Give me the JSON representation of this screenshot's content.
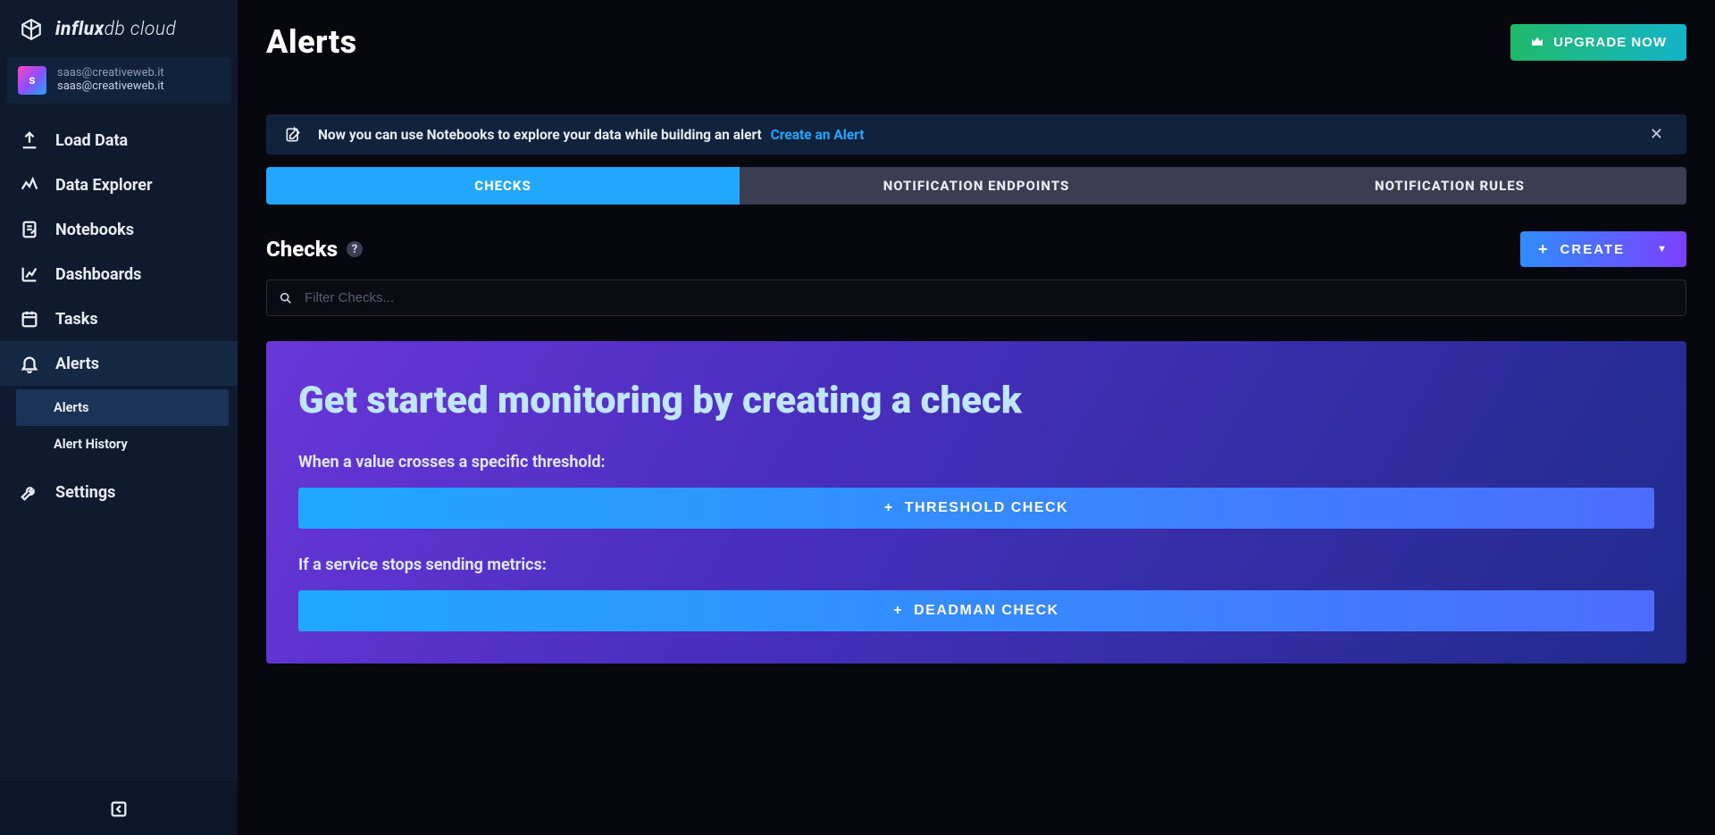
{
  "brand": {
    "bold": "influx",
    "thin": "db cloud"
  },
  "account": {
    "avatar_letter": "s",
    "line1": "saas@creativeweb.it",
    "line2": "saas@creativeweb.it"
  },
  "nav": {
    "load_data": "Load Data",
    "data_explorer": "Data Explorer",
    "notebooks": "Notebooks",
    "dashboards": "Dashboards",
    "tasks": "Tasks",
    "alerts": "Alerts",
    "settings": "Settings"
  },
  "subnav": {
    "alerts": "Alerts",
    "alert_history": "Alert History"
  },
  "page": {
    "title": "Alerts",
    "upgrade": "UPGRADE NOW"
  },
  "banner": {
    "text": "Now you can use Notebooks to explore your data while building an alert",
    "link": "Create an Alert"
  },
  "tabs": {
    "checks": "CHECKS",
    "endpoints": "NOTIFICATION ENDPOINTS",
    "rules": "NOTIFICATION RULES"
  },
  "section": {
    "title": "Checks",
    "create": "CREATE",
    "filter_placeholder": "Filter Checks..."
  },
  "getting_started": {
    "title": "Get started monitoring by creating a check",
    "threshold_sub": "When a value crosses a specific threshold:",
    "threshold_btn": "THRESHOLD CHECK",
    "deadman_sub": "If a service stops sending metrics:",
    "deadman_btn": "DEADMAN CHECK"
  }
}
